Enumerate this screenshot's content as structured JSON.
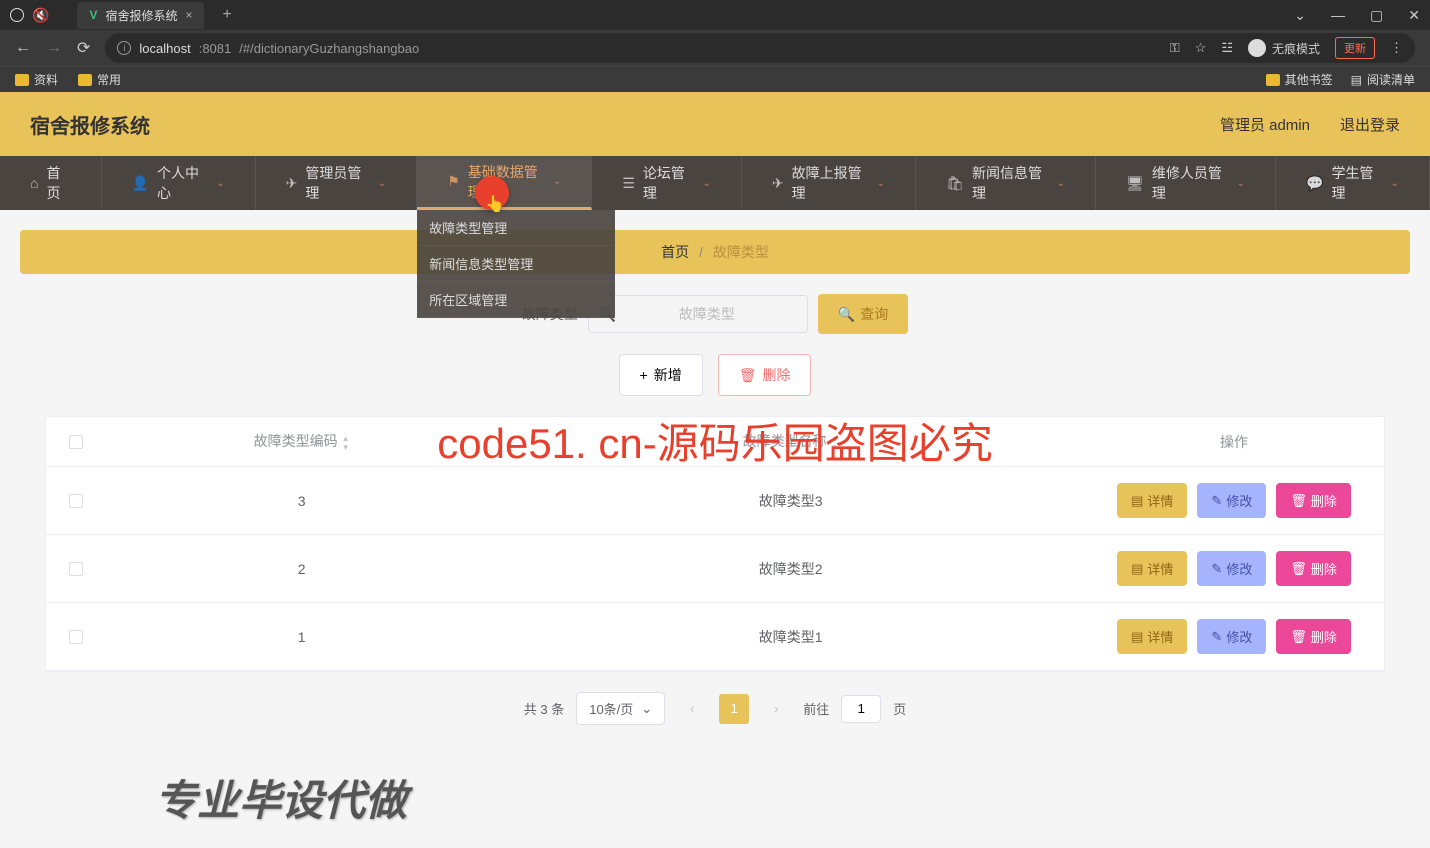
{
  "browser": {
    "tab_title": "宿舍报修系统",
    "url_host": "localhost",
    "url_port": ":8081",
    "url_path": "/#/dictionaryGuzhangshangbao",
    "incognito_label": "无痕模式",
    "update_label": "更新",
    "bookmarks": {
      "ziliao": "资料",
      "changyong": "常用",
      "other": "其他书签",
      "reading": "阅读清单"
    }
  },
  "header": {
    "title": "宿舍报修系统",
    "user_label": "管理员 admin",
    "logout": "退出登录"
  },
  "nav": {
    "home": "首页",
    "personal": "个人中心",
    "admin": "管理员管理",
    "basic": "基础数据管理",
    "forum": "论坛管理",
    "fault": "故障上报管理",
    "news": "新闻信息管理",
    "repair": "维修人员管理",
    "student": "学生管理"
  },
  "dropdown": {
    "item1": "故障类型管理",
    "item2": "新闻信息类型管理",
    "item3": "所在区域管理"
  },
  "breadcrumb": {
    "home": "首页",
    "current": "故障类型"
  },
  "search": {
    "label": "故障类型",
    "placeholder": "故障类型",
    "button": "查询"
  },
  "actions": {
    "add": "新增",
    "delete": "删除"
  },
  "watermark": "code51. cn-源码乐园盗图必究",
  "table": {
    "headers": {
      "code": "故障类型编码",
      "name": "故障类型名称",
      "ops": "操作"
    },
    "rows": [
      {
        "code": "3",
        "name": "故障类型3"
      },
      {
        "code": "2",
        "name": "故障类型2"
      },
      {
        "code": "1",
        "name": "故障类型1"
      }
    ],
    "op_labels": {
      "detail": "详情",
      "edit": "修改",
      "delete": "删除"
    }
  },
  "pagination": {
    "total": "共 3 条",
    "per_page": "10条/页",
    "current": "1",
    "goto_prefix": "前往",
    "goto_suffix": "页",
    "goto_value": "1"
  },
  "footer": "专业毕设代做"
}
